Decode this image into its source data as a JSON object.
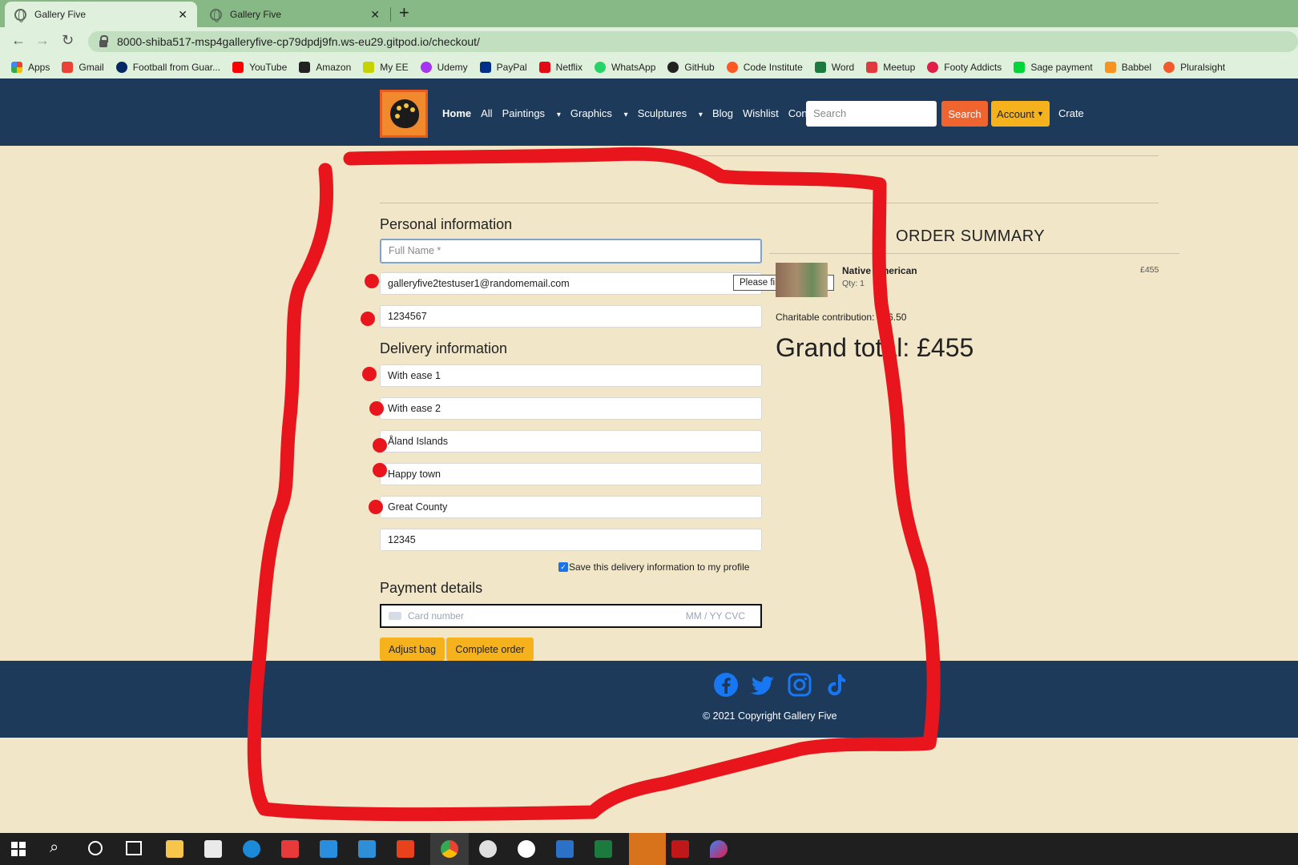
{
  "browser": {
    "tabs": [
      {
        "title": "Gallery Five",
        "active": true
      },
      {
        "title": "Gallery Five",
        "active": false
      }
    ],
    "url": "8000-shiba517-msp4galleryfive-cp79dpdj9fn.ws-eu29.gitpod.io/checkout/",
    "bookmarks": [
      "Apps",
      "Gmail",
      "Football from Guar...",
      "YouTube",
      "Amazon",
      "My EE",
      "Udemy",
      "PayPal",
      "Netflix",
      "WhatsApp",
      "GitHub",
      "Code Institute",
      "Word",
      "Meetup",
      "Footy Addicts",
      "Sage payment",
      "Babbel",
      "Pluralsight"
    ]
  },
  "nav": {
    "links": [
      "Home",
      "All",
      "Paintings",
      "Graphics",
      "Sculptures",
      "Blog",
      "Wishlist",
      "Contact"
    ],
    "search_placeholder": "Search",
    "search_button": "Search",
    "account_button": "Account",
    "crate": "Crate"
  },
  "checkout": {
    "personal_title": "Personal information",
    "full_name_placeholder": "Full Name *",
    "email": "galleryfive2testuser1@randomemail.com",
    "phone": "1234567",
    "tooltip": "Please fill in this field.",
    "delivery_title": "Delivery information",
    "street1": "With ease 1",
    "street2": "With ease 2",
    "country": "Åland Islands",
    "town": "Happy town",
    "county": "Great County",
    "postcode": "12345",
    "save_label": "Save this delivery information to my profile",
    "payment_title": "Payment details",
    "card_placeholder": "Card number",
    "card_extra": "MM / YY  CVC",
    "adjust_bag": "Adjust bag",
    "complete_order": "Complete order"
  },
  "summary": {
    "title": "ORDER SUMMARY",
    "product_name": "Native American",
    "qty": "Qty: 1",
    "price": "£455",
    "charity": "Charitable contribution: £36.50",
    "grand_total": "Grand total: £455"
  },
  "footer": {
    "copyright": "© 2021 Copyright Gallery Five"
  },
  "colors": {
    "nav_bg": "#1e3a5a",
    "page_bg": "#f1e6c8",
    "accent_orange": "#f0642f",
    "accent_yellow": "#f5b21c",
    "annotation_red": "#e8161c",
    "social_blue": "#1877f2"
  }
}
